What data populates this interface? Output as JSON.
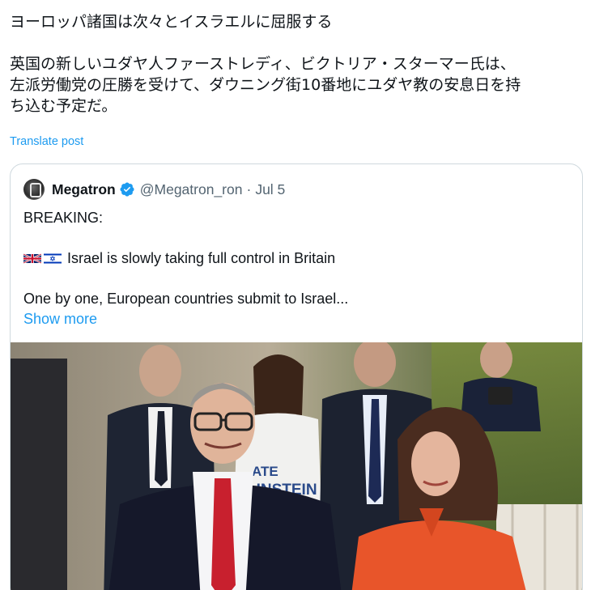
{
  "post": {
    "line1": "ヨーロッパ諸国は次々とイスラエルに屈服する",
    "line2": "英国の新しいユダヤ人ファーストレディ、ビクトリア・スターマー氏は、",
    "line3": "左派労働党の圧勝を受けて、ダウニング街10番地にユダヤ教の安息日を持",
    "line4": "ち込む予定だ。",
    "translate_label": "Translate post"
  },
  "quote": {
    "name": "Megatron",
    "handle": "@Megatron_ron",
    "separator": "·",
    "date": "Jul 5",
    "avatar_icon": "megatron-avatar",
    "verified_icon": "verified-badge-icon",
    "breaking": "BREAKING:",
    "flags": [
      "uk-flag-icon",
      "israel-flag-icon"
    ],
    "headline": "Israel is slowly taking full control in Britain",
    "body": "One by one, European countries submit to Israel...",
    "show_more": "Show more"
  },
  "photo": {
    "shirt_text_1": "ATE",
    "shirt_text_2": "LINSTEIN"
  },
  "colors": {
    "accent": "#1d9bf0",
    "text": "#0f1419",
    "muted": "#536471",
    "border": "#cfd9de"
  }
}
